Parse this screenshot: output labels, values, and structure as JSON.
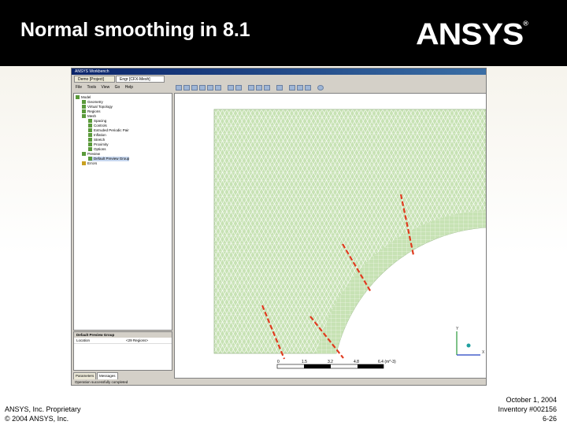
{
  "slide": {
    "title": "Normal smoothing in 8.1",
    "logo": "ANSYS",
    "logo_mark": "®"
  },
  "app": {
    "window_title": "ANSYS Workbench",
    "tabs": [
      "Demo [Project]",
      "Engr [CFX-Mesh]"
    ],
    "menu": [
      "File",
      "Tools",
      "View",
      "Go",
      "Help"
    ],
    "tree": [
      "Model",
      "Geometry",
      "Virtual Topology",
      "Regions",
      "Mesh",
      "Spacing",
      "Controls",
      "Extruded Periodic Pair",
      "Inflation",
      "Stretch",
      "Proximity",
      "Options",
      "Preview",
      "Default Preview Group",
      "Errors"
    ],
    "properties": {
      "header": "Default Preview Group",
      "row_label": "Location",
      "row_value": "<29 Regions>"
    },
    "bottom_tabs": [
      "Parameters",
      "Messages"
    ],
    "status": "Operation successfully completed",
    "scale_labels": [
      "0",
      "1.5",
      "3.2",
      "4.8",
      "6.4 (m^-3)"
    ],
    "triad_labels": [
      "Y",
      "X"
    ]
  },
  "footer": {
    "company": "ANSYS, Inc. Proprietary",
    "copyright": "© 2004 ANSYS, Inc.",
    "date": "October 1, 2004",
    "inventory": "Inventory #002156",
    "page": "6-26"
  },
  "colors": {
    "header_bg": "#000000",
    "mesh_fill": "#c7e2b4",
    "mesh_line": "#ffffff",
    "highlight_line": "#e03a1e",
    "tree_icon": "#5a9a3a"
  }
}
